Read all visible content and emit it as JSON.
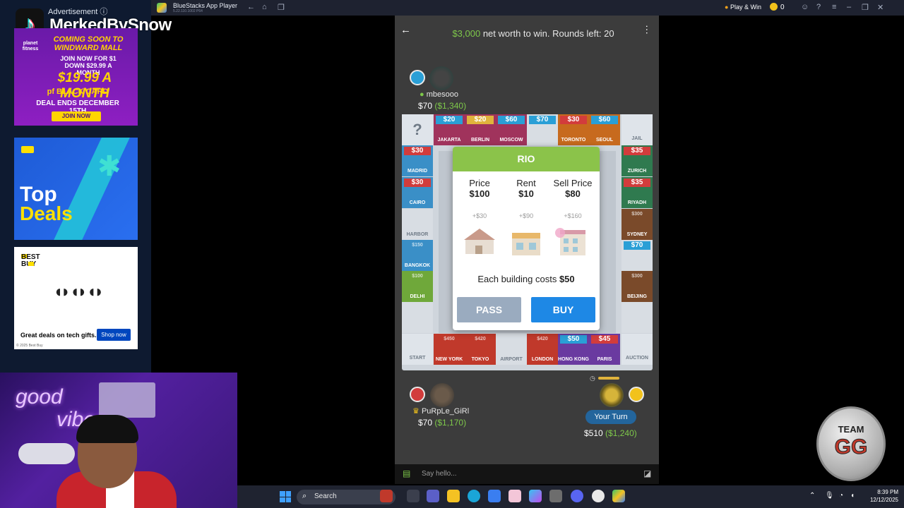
{
  "ads": {
    "label": "Advertisement ⓘ",
    "overlay_name": "MerkedBySnow",
    "ad1": {
      "brand": "planet fitness",
      "line1": "COMING SOON TO WINDWARD MALL",
      "line2": "JOIN NOW FOR $1 DOWN $29.99 A MONTH",
      "line3": "$19.99 A MONTH",
      "line4": "pf BLACK CARD",
      "line5": "DEAL ENDS DECEMBER 15TH",
      "button": "JOIN NOW"
    },
    "ad2": {
      "line1": "Top",
      "line2": "Deals"
    },
    "ad3": {
      "brand": "BEST BUY",
      "text": "Great deals on tech gifts.",
      "button": "Shop now",
      "copyright": "© 2025 Best Buy"
    }
  },
  "titlebar": {
    "app_title": "BlueStacks App Player",
    "app_sub": "5.22.110.1002 P64",
    "play_win": "Play & Win",
    "coins": "0"
  },
  "game": {
    "goal_amount": "$3,000",
    "goal_text": " net worth to win. Rounds left: 20",
    "players": {
      "top": {
        "name": "mbesooo",
        "cash": "$70",
        "worth": "($1,340)"
      },
      "left": {
        "name": "PuRpLe_GiRl",
        "cash": "$70",
        "worth": "($1,170)"
      },
      "me": {
        "turn_label": "Your Turn",
        "cash": "$510",
        "worth": "($1,240)"
      }
    },
    "board": {
      "top_row": [
        {
          "name": "JAKARTA",
          "price": "$20",
          "color": "#a0335c",
          "band": "#2a9fd6"
        },
        {
          "name": "BERLIN",
          "price": "$20",
          "color": "#a0335c",
          "band": "#e0b33c"
        },
        {
          "name": "MOSCOW",
          "price": "$60",
          "color": "#a0335c",
          "band": "#2a9fd6"
        },
        {
          "name": "",
          "price": "$70",
          "color": "#d8dde3",
          "band": "#2a9fd6"
        },
        {
          "name": "TORONTO",
          "price": "$30",
          "color": "#c76a1e",
          "band": "#d23c3c"
        },
        {
          "name": "SEOUL",
          "price": "$60",
          "color": "#c76a1e",
          "band": "#2a9fd6"
        }
      ],
      "left_col": [
        {
          "name": "MADRID",
          "price": "$30",
          "color": "#3a8fc7",
          "band": "#d23c3c"
        },
        {
          "name": "CAIRO",
          "price": "$30",
          "color": "#3a8fc7",
          "band": "#d23c3c"
        },
        {
          "name": "HARBOR",
          "price": "",
          "color": "#d8dde3",
          "band": ""
        },
        {
          "name": "BANGKOK",
          "price": "$150",
          "color": "#3a8fc7",
          "band": ""
        },
        {
          "name": "DELHI",
          "price": "$100",
          "color": "#6fa83a",
          "band": ""
        },
        {
          "name": "",
          "price": "",
          "color": "#d8dde3",
          "band": ""
        }
      ],
      "right_col": [
        {
          "name": "ZURICH",
          "price": "$35",
          "color": "#2f7a4f",
          "band": "#d23c3c"
        },
        {
          "name": "RIYADH",
          "price": "$35",
          "color": "#2f7a4f",
          "band": "#d23c3c"
        },
        {
          "name": "SYDNEY",
          "price": "$300",
          "color": "#7a4a2a",
          "band": ""
        },
        {
          "name": "",
          "price": "$70",
          "color": "#d8dde3",
          "band": "#2a9fd6"
        },
        {
          "name": "BEIJING",
          "price": "$300",
          "color": "#7a4a2a",
          "band": ""
        },
        {
          "name": "",
          "price": "",
          "color": "#d8dde3",
          "band": ""
        }
      ],
      "bottom_row": [
        {
          "name": "NEW YORK",
          "price": "$450",
          "color": "#c0392b",
          "band": ""
        },
        {
          "name": "TOKYO",
          "price": "$420",
          "color": "#c0392b",
          "band": ""
        },
        {
          "name": "AIRPORT",
          "price": "",
          "color": "#d8dde3",
          "band": ""
        },
        {
          "name": "LONDON",
          "price": "$420",
          "color": "#c0392b",
          "band": ""
        },
        {
          "name": "HONG KONG",
          "price": "$50",
          "color": "#6a3aa0",
          "band": "#2a9fd6"
        },
        {
          "name": "PARIS",
          "price": "$45",
          "color": "#6a3aa0",
          "band": "#d23c3c"
        }
      ],
      "corners": {
        "top_left": "?",
        "top_right": "JAIL",
        "bottom_left": "START",
        "bottom_right": "AUCTION"
      }
    },
    "modal": {
      "title": "RIO",
      "price_label": "Price",
      "price_value": "$100",
      "rent_label": "Rent",
      "rent_value": "$10",
      "sell_label": "Sell Price",
      "sell_value": "$80",
      "increments": [
        "+$30",
        "+$90",
        "+$160"
      ],
      "building_cost_text": "Each building costs ",
      "building_cost_value": "$50",
      "pass": "PASS",
      "buy": "BUY"
    },
    "chat_placeholder": "Say hello..."
  },
  "webcam": {
    "neon1": "good",
    "neon2": "vibes"
  },
  "badge": {
    "line1": "TEAM",
    "line2": "GG"
  },
  "taskbar": {
    "search": "Search",
    "time": "8:39 PM",
    "date": "12/12/2025"
  }
}
